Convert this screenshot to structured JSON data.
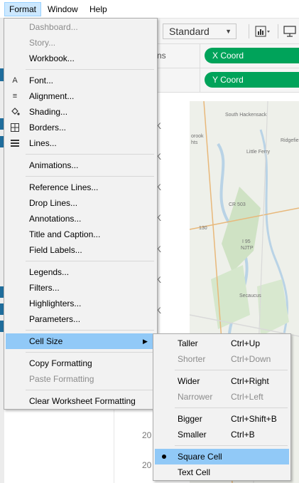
{
  "menubar": {
    "format": "Format",
    "window": "Window",
    "help": "Help"
  },
  "toolbar": {
    "fit_select": "Standard"
  },
  "shelves": {
    "columns_label_fragment": "ns",
    "columns_pill": "X Coord",
    "rows_pill": "Y Coord"
  },
  "axis": {
    "ticks": [
      "K",
      "K",
      "K",
      "K",
      "K",
      "K",
      "K"
    ],
    "bottom_ticks": [
      "20",
      "20"
    ]
  },
  "map_labels": [
    "South Hackensack",
    "orook",
    "hts",
    "Ridgefie",
    "Little Ferry",
    "CR 503",
    "130",
    "I 95",
    "NJTP",
    "Secaucus"
  ],
  "format_menu": {
    "items": [
      {
        "label": "Dashboard...",
        "disabled": true
      },
      {
        "label": "Story...",
        "disabled": true
      },
      {
        "label": "Workbook...",
        "disabled": false
      },
      {
        "label": "Font...",
        "icon": "font-icon"
      },
      {
        "label": "Alignment...",
        "icon": "alignment-icon"
      },
      {
        "label": "Shading...",
        "icon": "shading-icon"
      },
      {
        "label": "Borders...",
        "icon": "borders-icon"
      },
      {
        "label": "Lines...",
        "icon": "lines-icon"
      },
      {
        "label": "Animations..."
      },
      {
        "label": "Reference Lines..."
      },
      {
        "label": "Drop Lines..."
      },
      {
        "label": "Annotations..."
      },
      {
        "label": "Title and Caption..."
      },
      {
        "label": "Field Labels..."
      },
      {
        "label": "Legends..."
      },
      {
        "label": "Filters..."
      },
      {
        "label": "Highlighters..."
      },
      {
        "label": "Parameters..."
      },
      {
        "label": "Cell Size",
        "highlighted": true,
        "submenu_arrow": "▶"
      },
      {
        "label": "Copy Formatting"
      },
      {
        "label": "Paste Formatting",
        "disabled": true
      },
      {
        "label": "Clear Worksheet Formatting"
      }
    ]
  },
  "cell_size_menu": {
    "items": [
      {
        "label": "Taller",
        "shortcut": "Ctrl+Up"
      },
      {
        "label": "Shorter",
        "shortcut": "Ctrl+Down",
        "disabled": true
      },
      {
        "label": "Wider",
        "shortcut": "Ctrl+Right"
      },
      {
        "label": "Narrower",
        "shortcut": "Ctrl+Left",
        "disabled": true
      },
      {
        "label": "Bigger",
        "shortcut": "Ctrl+Shift+B"
      },
      {
        "label": "Smaller",
        "shortcut": "Ctrl+B"
      },
      {
        "label": "Square Cell",
        "selected": true,
        "highlighted": true
      },
      {
        "label": "Text Cell"
      }
    ]
  }
}
